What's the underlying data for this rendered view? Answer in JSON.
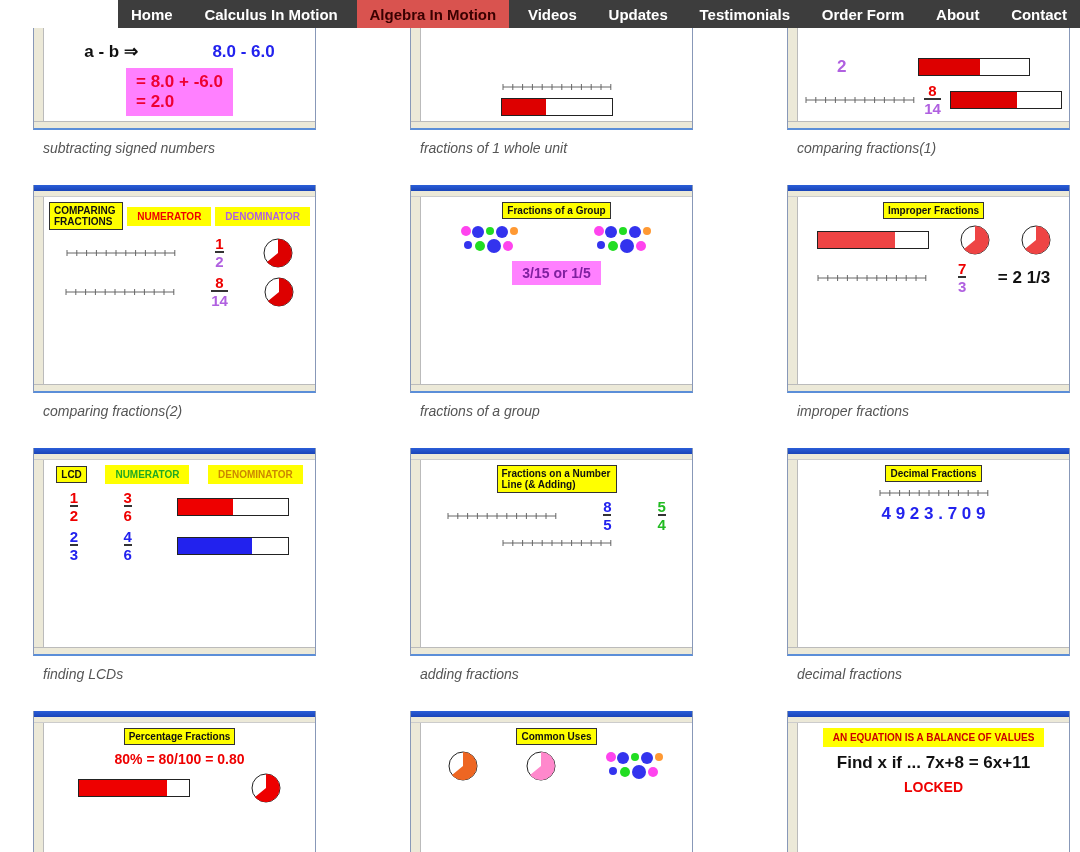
{
  "nav": {
    "items": [
      {
        "label": "Home",
        "selected": false
      },
      {
        "label": "Calculus In Motion",
        "selected": false
      },
      {
        "label": "Algebra In Motion",
        "selected": true
      },
      {
        "label": "Videos",
        "selected": false
      },
      {
        "label": "Updates",
        "selected": false
      },
      {
        "label": "Testimonials",
        "selected": false
      },
      {
        "label": "Order Form",
        "selected": false
      },
      {
        "label": "About",
        "selected": false
      },
      {
        "label": "Contact",
        "selected": false
      }
    ]
  },
  "gallery": [
    {
      "caption": "subtracting signed numbers",
      "rows": [
        [
          {
            "kind": "big",
            "text": "a - b ⇒",
            "color": "#111111"
          },
          {
            "kind": "big",
            "text": "8.0  -  6.0",
            "color": "#2222ee"
          }
        ],
        [
          {
            "kind": "box",
            "color": "#ff80ff",
            "items": [
              {
                "kind": "big",
                "text": "= 8.0  +  -6.0",
                "color": "#ee0033"
              },
              {
                "kind": "big",
                "text": "= 2.0",
                "color": "#ee0033"
              }
            ]
          }
        ]
      ]
    },
    {
      "caption": "fractions of 1 whole unit",
      "rows": [
        [
          {
            "kind": "line"
          }
        ],
        [
          {
            "kind": "bar",
            "level": 0.4,
            "color": "#dd0000"
          }
        ]
      ]
    },
    {
      "caption": "comparing fractions(1)",
      "rows": [
        [
          {
            "kind": "big",
            "text": "2",
            "color": "#b060e0"
          },
          {
            "kind": "bar",
            "level": 0.55,
            "color": "#dd0000"
          }
        ],
        [
          {
            "kind": "line"
          },
          {
            "kind": "fraction",
            "num": {
              "text": "8",
              "color": "#ee0000"
            },
            "den": {
              "text": "14",
              "color": "#b060e0"
            }
          },
          {
            "kind": "bar",
            "level": 0.6,
            "color": "#dd0000"
          }
        ]
      ]
    },
    {
      "caption": "comparing fractions(2)",
      "rows": [
        [
          {
            "kind": "heading",
            "text": "COMPARING FRACTIONS"
          },
          {
            "kind": "box",
            "color": "#ffff00",
            "items": [
              {
                "kind": "small",
                "text": "NUMERATOR",
                "color": "#ee0000"
              }
            ]
          },
          {
            "kind": "box",
            "color": "#ffff00",
            "items": [
              {
                "kind": "small",
                "text": "DENOMINATOR",
                "color": "#b060e0"
              }
            ]
          }
        ],
        [
          {
            "kind": "line"
          },
          {
            "kind": "fraction",
            "num": {
              "text": "1",
              "color": "#ee0000"
            },
            "den": {
              "text": "2",
              "color": "#b060e0"
            }
          },
          {
            "kind": "pie",
            "color": "#dd0000"
          }
        ],
        [
          {
            "kind": "line"
          },
          {
            "kind": "fraction",
            "num": {
              "text": "8",
              "color": "#ee0000"
            },
            "den": {
              "text": "14",
              "color": "#b060e0"
            }
          },
          {
            "kind": "pie",
            "color": "#dd0000"
          }
        ]
      ]
    },
    {
      "caption": "fractions of a group",
      "rows": [
        [
          {
            "kind": "heading",
            "text": "Fractions of a Group"
          }
        ],
        [
          {
            "kind": "dots"
          },
          {
            "kind": "dots"
          }
        ],
        [
          {
            "kind": "box",
            "color": "#ff80ff",
            "items": [
              {
                "kind": "medium",
                "text": "3/15 or 1/5",
                "color": "#8020a0"
              }
            ]
          }
        ]
      ]
    },
    {
      "caption": "improper fractions",
      "rows": [
        [
          {
            "kind": "heading",
            "text": "Improper Fractions"
          }
        ],
        [
          {
            "kind": "bar",
            "level": 0.7,
            "color": "#ee4444"
          },
          {
            "kind": "pie",
            "color": "#ee4444"
          },
          {
            "kind": "pie",
            "color": "#ee4444"
          }
        ],
        [
          {
            "kind": "line"
          },
          {
            "kind": "fraction",
            "num": {
              "text": "7",
              "color": "#ee0000"
            },
            "den": {
              "text": "3",
              "color": "#b060e0"
            }
          },
          {
            "kind": "big",
            "text": "= 2 1/3",
            "color": "#111111"
          }
        ]
      ]
    },
    {
      "caption": "finding LCDs",
      "rows": [
        [
          {
            "kind": "heading",
            "text": "LCD"
          },
          {
            "kind": "box",
            "color": "#ffff00",
            "items": [
              {
                "kind": "small",
                "text": "NUMERATOR",
                "color": "#22aa22"
              }
            ]
          },
          {
            "kind": "box",
            "color": "#ffff00",
            "items": [
              {
                "kind": "small",
                "text": "DENOMINATOR",
                "color": "#cc8800"
              }
            ]
          }
        ],
        [
          {
            "kind": "fraction",
            "num": {
              "text": "1",
              "color": "#ee0000"
            },
            "den": {
              "text": "2",
              "color": "#ee0000"
            }
          },
          {
            "kind": "fraction",
            "num": {
              "text": "3",
              "color": "#ee0000"
            },
            "den": {
              "text": "6",
              "color": "#ee0000"
            }
          },
          {
            "kind": "bar",
            "level": 0.5,
            "color": "#ee0000"
          }
        ],
        [
          {
            "kind": "fraction",
            "num": {
              "text": "2",
              "color": "#2222ee"
            },
            "den": {
              "text": "3",
              "color": "#2222ee"
            }
          },
          {
            "kind": "fraction",
            "num": {
              "text": "4",
              "color": "#2222ee"
            },
            "den": {
              "text": "6",
              "color": "#2222ee"
            }
          },
          {
            "kind": "bar",
            "level": 0.67,
            "color": "#2222ee"
          }
        ]
      ]
    },
    {
      "caption": "adding fractions",
      "rows": [
        [
          {
            "kind": "heading",
            "text": "Fractions on a Number Line (& Adding)"
          }
        ],
        [
          {
            "kind": "line"
          },
          {
            "kind": "fraction",
            "num": {
              "text": "8",
              "color": "#2222ee"
            },
            "den": {
              "text": "5",
              "color": "#2222ee"
            }
          },
          {
            "kind": "fraction",
            "num": {
              "text": "5",
              "color": "#22bb22"
            },
            "den": {
              "text": "4",
              "color": "#22bb22"
            }
          }
        ],
        [
          {
            "kind": "line"
          }
        ]
      ]
    },
    {
      "caption": "decimal fractions",
      "rows": [
        [
          {
            "kind": "heading",
            "text": "Decimal Fractions"
          }
        ],
        [
          {
            "kind": "line"
          }
        ],
        [
          {
            "kind": "big",
            "text": "4 9 2 3 . 7 0 9",
            "color": "#2222ee"
          }
        ]
      ]
    },
    {
      "rows": [
        [
          {
            "kind": "heading",
            "text": "Percentage Fractions"
          }
        ],
        [
          {
            "kind": "medium",
            "text": "80%  =  80/100  =  0.80",
            "color": "#ee0000"
          }
        ],
        [
          {
            "kind": "bar",
            "level": 0.8,
            "color": "#ee0000"
          },
          {
            "kind": "pie",
            "color": "#ee0000"
          }
        ]
      ]
    },
    {
      "rows": [
        [
          {
            "kind": "heading",
            "text": "Common Uses"
          }
        ],
        [
          {
            "kind": "pie",
            "color": "#ee6622"
          },
          {
            "kind": "pie",
            "color": "#ff88cc"
          },
          {
            "kind": "dots"
          }
        ]
      ]
    },
    {
      "rows": [
        [
          {
            "kind": "box",
            "color": "#ffff00",
            "items": [
              {
                "kind": "small",
                "text": "AN EQUATION IS A BALANCE OF VALUES",
                "color": "#cc0000"
              }
            ]
          }
        ],
        [
          {
            "kind": "big",
            "text": "Find x if ... 7x+8 = 6x+11",
            "color": "#111111"
          }
        ],
        [
          {
            "kind": "medium",
            "text": "LOCKED",
            "color": "#ee0000"
          }
        ]
      ]
    }
  ]
}
